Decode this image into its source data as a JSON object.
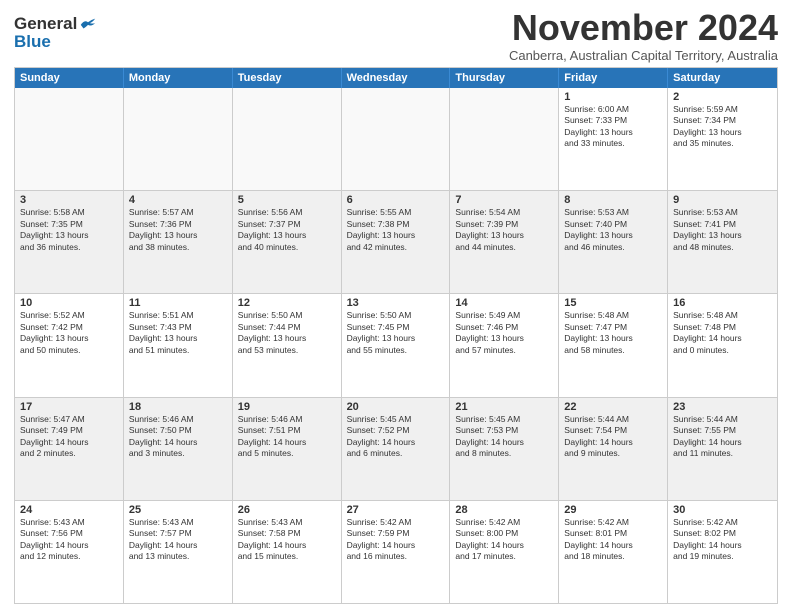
{
  "logo": {
    "line1": "General",
    "line2": "Blue"
  },
  "title": "November 2024",
  "subtitle": "Canberra, Australian Capital Territory, Australia",
  "days": [
    "Sunday",
    "Monday",
    "Tuesday",
    "Wednesday",
    "Thursday",
    "Friday",
    "Saturday"
  ],
  "rows": [
    [
      {
        "day": "",
        "info": ""
      },
      {
        "day": "",
        "info": ""
      },
      {
        "day": "",
        "info": ""
      },
      {
        "day": "",
        "info": ""
      },
      {
        "day": "",
        "info": ""
      },
      {
        "day": "1",
        "info": "Sunrise: 6:00 AM\nSunset: 7:33 PM\nDaylight: 13 hours\nand 33 minutes."
      },
      {
        "day": "2",
        "info": "Sunrise: 5:59 AM\nSunset: 7:34 PM\nDaylight: 13 hours\nand 35 minutes."
      }
    ],
    [
      {
        "day": "3",
        "info": "Sunrise: 5:58 AM\nSunset: 7:35 PM\nDaylight: 13 hours\nand 36 minutes."
      },
      {
        "day": "4",
        "info": "Sunrise: 5:57 AM\nSunset: 7:36 PM\nDaylight: 13 hours\nand 38 minutes."
      },
      {
        "day": "5",
        "info": "Sunrise: 5:56 AM\nSunset: 7:37 PM\nDaylight: 13 hours\nand 40 minutes."
      },
      {
        "day": "6",
        "info": "Sunrise: 5:55 AM\nSunset: 7:38 PM\nDaylight: 13 hours\nand 42 minutes."
      },
      {
        "day": "7",
        "info": "Sunrise: 5:54 AM\nSunset: 7:39 PM\nDaylight: 13 hours\nand 44 minutes."
      },
      {
        "day": "8",
        "info": "Sunrise: 5:53 AM\nSunset: 7:40 PM\nDaylight: 13 hours\nand 46 minutes."
      },
      {
        "day": "9",
        "info": "Sunrise: 5:53 AM\nSunset: 7:41 PM\nDaylight: 13 hours\nand 48 minutes."
      }
    ],
    [
      {
        "day": "10",
        "info": "Sunrise: 5:52 AM\nSunset: 7:42 PM\nDaylight: 13 hours\nand 50 minutes."
      },
      {
        "day": "11",
        "info": "Sunrise: 5:51 AM\nSunset: 7:43 PM\nDaylight: 13 hours\nand 51 minutes."
      },
      {
        "day": "12",
        "info": "Sunrise: 5:50 AM\nSunset: 7:44 PM\nDaylight: 13 hours\nand 53 minutes."
      },
      {
        "day": "13",
        "info": "Sunrise: 5:50 AM\nSunset: 7:45 PM\nDaylight: 13 hours\nand 55 minutes."
      },
      {
        "day": "14",
        "info": "Sunrise: 5:49 AM\nSunset: 7:46 PM\nDaylight: 13 hours\nand 57 minutes."
      },
      {
        "day": "15",
        "info": "Sunrise: 5:48 AM\nSunset: 7:47 PM\nDaylight: 13 hours\nand 58 minutes."
      },
      {
        "day": "16",
        "info": "Sunrise: 5:48 AM\nSunset: 7:48 PM\nDaylight: 14 hours\nand 0 minutes."
      }
    ],
    [
      {
        "day": "17",
        "info": "Sunrise: 5:47 AM\nSunset: 7:49 PM\nDaylight: 14 hours\nand 2 minutes."
      },
      {
        "day": "18",
        "info": "Sunrise: 5:46 AM\nSunset: 7:50 PM\nDaylight: 14 hours\nand 3 minutes."
      },
      {
        "day": "19",
        "info": "Sunrise: 5:46 AM\nSunset: 7:51 PM\nDaylight: 14 hours\nand 5 minutes."
      },
      {
        "day": "20",
        "info": "Sunrise: 5:45 AM\nSunset: 7:52 PM\nDaylight: 14 hours\nand 6 minutes."
      },
      {
        "day": "21",
        "info": "Sunrise: 5:45 AM\nSunset: 7:53 PM\nDaylight: 14 hours\nand 8 minutes."
      },
      {
        "day": "22",
        "info": "Sunrise: 5:44 AM\nSunset: 7:54 PM\nDaylight: 14 hours\nand 9 minutes."
      },
      {
        "day": "23",
        "info": "Sunrise: 5:44 AM\nSunset: 7:55 PM\nDaylight: 14 hours\nand 11 minutes."
      }
    ],
    [
      {
        "day": "24",
        "info": "Sunrise: 5:43 AM\nSunset: 7:56 PM\nDaylight: 14 hours\nand 12 minutes."
      },
      {
        "day": "25",
        "info": "Sunrise: 5:43 AM\nSunset: 7:57 PM\nDaylight: 14 hours\nand 13 minutes."
      },
      {
        "day": "26",
        "info": "Sunrise: 5:43 AM\nSunset: 7:58 PM\nDaylight: 14 hours\nand 15 minutes."
      },
      {
        "day": "27",
        "info": "Sunrise: 5:42 AM\nSunset: 7:59 PM\nDaylight: 14 hours\nand 16 minutes."
      },
      {
        "day": "28",
        "info": "Sunrise: 5:42 AM\nSunset: 8:00 PM\nDaylight: 14 hours\nand 17 minutes."
      },
      {
        "day": "29",
        "info": "Sunrise: 5:42 AM\nSunset: 8:01 PM\nDaylight: 14 hours\nand 18 minutes."
      },
      {
        "day": "30",
        "info": "Sunrise: 5:42 AM\nSunset: 8:02 PM\nDaylight: 14 hours\nand 19 minutes."
      }
    ]
  ]
}
